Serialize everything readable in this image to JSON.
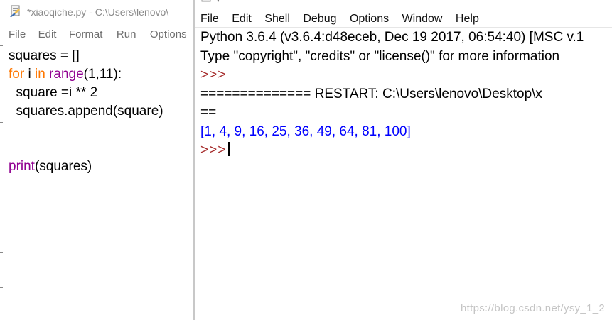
{
  "editor": {
    "title": "*xiaoqiche.py - C:\\Users\\lenovo\\",
    "menu": [
      "File",
      "Edit",
      "Format",
      "Run",
      "Options"
    ],
    "code": {
      "line1": "squares = []",
      "line2_kw1": "for",
      "line2_var": " i ",
      "line2_kw2": "in",
      "line2_sp": " ",
      "line2_fn": "range",
      "line2_rest": "(1,11):",
      "line3": "  square =i ** 2",
      "line4": "  squares.append(square)",
      "line7_fn": "print",
      "line7_rest": "(squares)"
    }
  },
  "shell": {
    "menu": {
      "file_u": "F",
      "file_rest": "ile",
      "edit_u": "E",
      "edit_rest": "dit",
      "shell_pre": "She",
      "shell_u": "l",
      "shell_rest": "l",
      "debug_u": "D",
      "debug_rest": "ebug",
      "options_u": "O",
      "options_rest": "ptions",
      "window_u": "W",
      "window_rest": "indow",
      "help_u": "H",
      "help_rest": "elp"
    },
    "banner_line1": "Python 3.6.4 (v3.6.4:d48eceb, Dec 19 2017, 06:54:40) [MSC v.1",
    "banner_line2": "Type \"copyright\", \"credits\" or \"license()\" for more information",
    "prompt": ">>>",
    "restart_line": "============== RESTART: C:\\Users\\lenovo\\Desktop\\x",
    "restart_cont": "==",
    "result": "[1, 4, 9, 16, 25, 36, 49, 64, 81, 100]",
    "watermark": "https://blog.csdn.net/ysy_1_2"
  },
  "colors": {
    "keyword": "#ff7700",
    "builtin": "#900090",
    "prompt": "#a52a2a",
    "output": "#0000ff"
  },
  "icons": {
    "editor_app": "idle-file-icon"
  }
}
